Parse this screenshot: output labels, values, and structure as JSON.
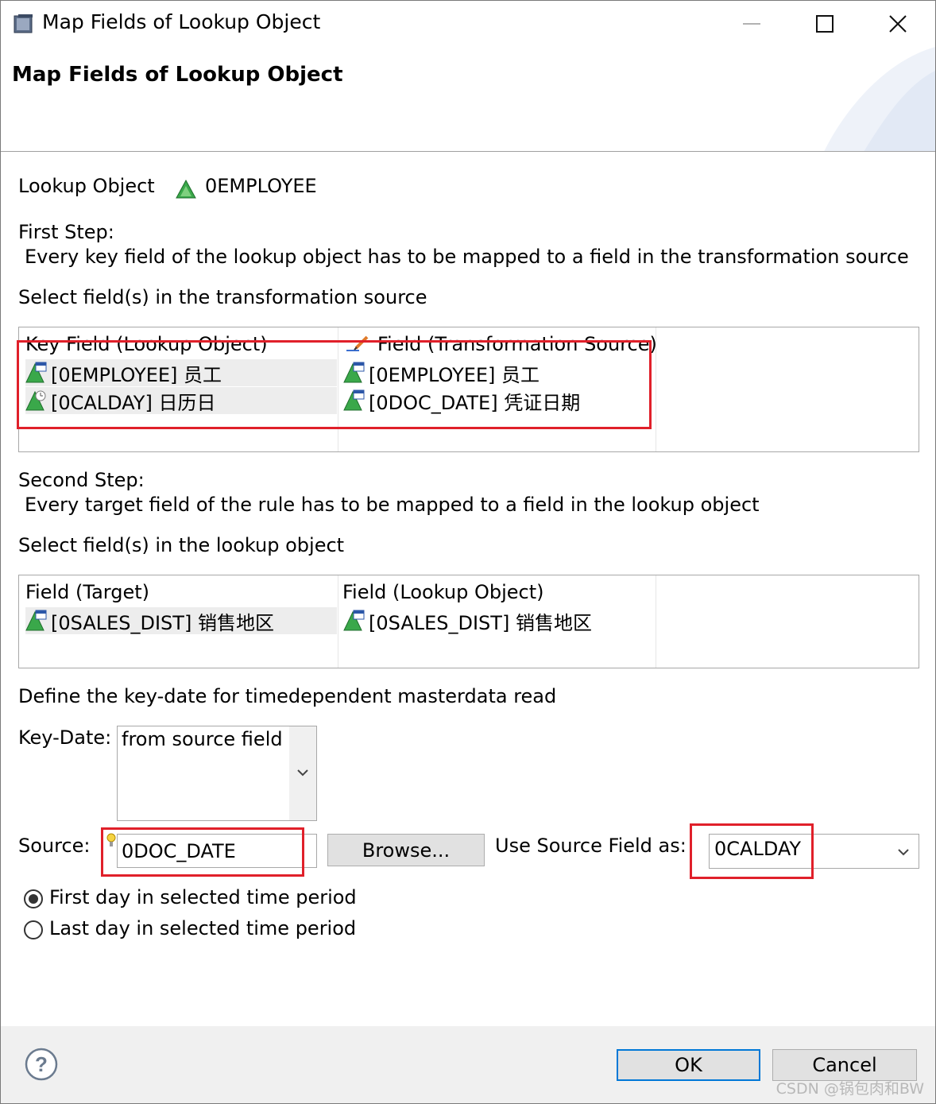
{
  "window": {
    "title": "Map Fields of Lookup Object"
  },
  "header": {
    "title": "Map Fields of Lookup Object"
  },
  "lookup": {
    "label": "Lookup Object",
    "value": "0EMPLOYEE"
  },
  "first_step": {
    "title": "First Step:",
    "desc": "Every key field of the lookup object has to be mapped to a field in the transformation source",
    "select_label": "Select field(s) in the transformation source",
    "columns": [
      "Key Field (Lookup Object)",
      "Field (Transformation Source)"
    ],
    "rows": [
      {
        "key": "[0EMPLOYEE] 员工",
        "source": "[0EMPLOYEE] 员工"
      },
      {
        "key": "[0CALDAY] 日历日",
        "source": "[0DOC_DATE] 凭证日期"
      }
    ]
  },
  "second_step": {
    "title": "Second Step:",
    "desc": "Every target field of the rule has to be mapped to a field in the lookup object",
    "select_label": "Select field(s) in the lookup object",
    "columns": [
      "Field (Target)",
      "Field (Lookup Object)"
    ],
    "rows": [
      {
        "target": "[0SALES_DIST] 销售地区",
        "lookup": "[0SALES_DIST] 销售地区"
      }
    ]
  },
  "keydate": {
    "section_label": "Define the key-date for timedependent masterdata read",
    "label": "Key-Date:",
    "value": "from source field",
    "source_label": "Source:",
    "source_value": "0DOC_DATE",
    "browse_label": "Browse...",
    "use_as_label": "Use Source Field as:",
    "use_as_value": "0CALDAY",
    "radio_first": "First day in selected time period",
    "radio_last": "Last day in selected time period",
    "radio_first_selected": true
  },
  "footer": {
    "ok_label": "OK",
    "cancel_label": "Cancel"
  },
  "watermark": "CSDN @锅包肉和BW",
  "colors": {
    "highlight": "#e0202a",
    "selection": "#ededed",
    "ok_border": "#0078d7"
  }
}
